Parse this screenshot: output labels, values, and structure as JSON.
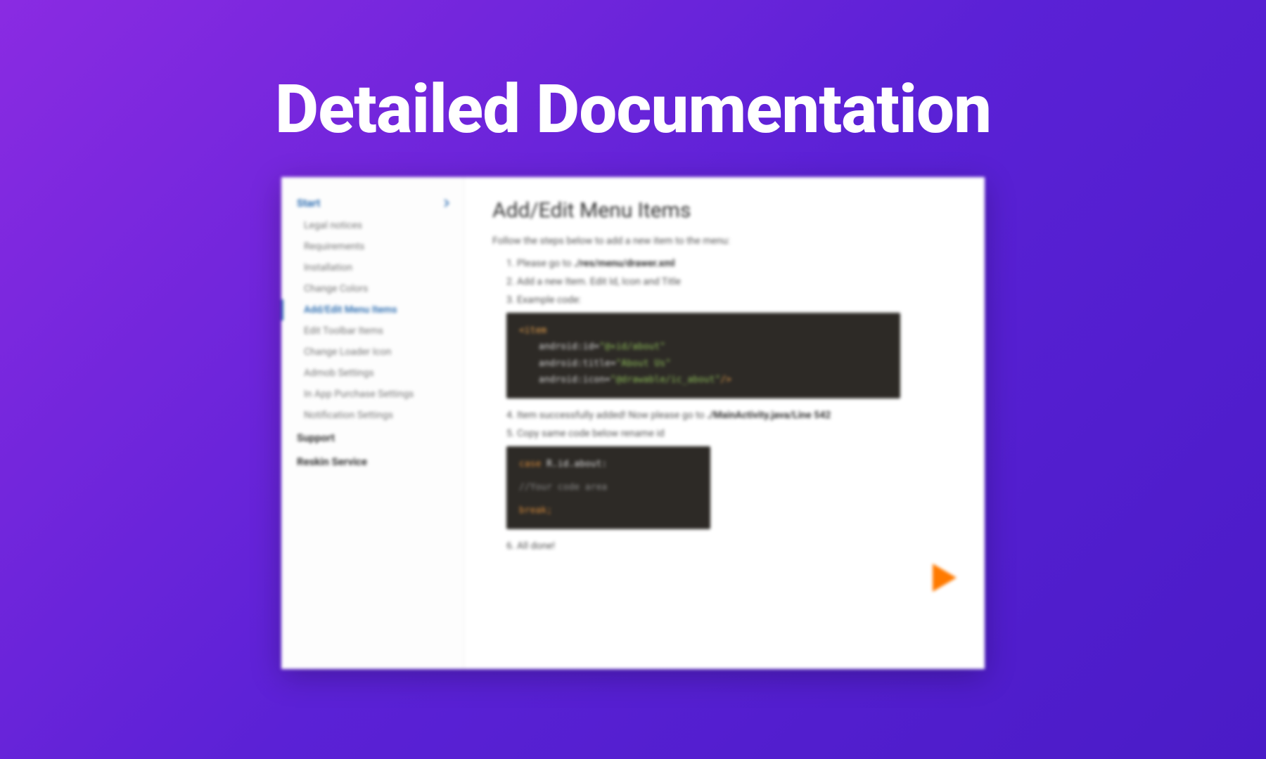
{
  "hero": {
    "title": "Detailed Documentation"
  },
  "sidebar": {
    "sections": [
      {
        "label": "Start",
        "expanded": true
      }
    ],
    "items": [
      {
        "label": "Legal notices"
      },
      {
        "label": "Requirements"
      },
      {
        "label": "Installation"
      },
      {
        "label": "Change Colors"
      },
      {
        "label": "Add/Edit Menu Items",
        "active": true
      },
      {
        "label": "Edit Toolbar Items"
      },
      {
        "label": "Change Loader Icon"
      },
      {
        "label": "Admob Settings"
      },
      {
        "label": "In App Purchase Settings"
      },
      {
        "label": "Notification Settings"
      }
    ],
    "plain": [
      {
        "label": "Support"
      },
      {
        "label": "Reskin Service"
      }
    ]
  },
  "content": {
    "title": "Add/Edit Menu Items",
    "intro": "Follow the steps below to add a new item to the menu:",
    "step1_prefix": "1. Please go to ",
    "step1_path": "./res/menu/drawer.xml",
    "step2": "2. Add a new Item. Edit Id, Icon and Title",
    "step3": "3. Example code:",
    "code1": {
      "l1_tag": "<item",
      "l2_attr": "android:id=",
      "l2_val": "\"@+id/about\"",
      "l3_attr": "android:title=",
      "l3_val": "\"About Us\"",
      "l4_attr": "android:icon=",
      "l4_val": "\"@drawable/ic_about\"",
      "l4_end": "/>"
    },
    "step4_prefix": "4. Item successfully added! Now please go to ",
    "step4_path": "./MainActivity.java/Line 542",
    "step5": "5. Copy same code below rename id",
    "code2": {
      "l1_key": "case ",
      "l1_rest": "R.id.about:",
      "l2": "//Your code area",
      "l3": "break;"
    },
    "step6": "6. All done!"
  }
}
